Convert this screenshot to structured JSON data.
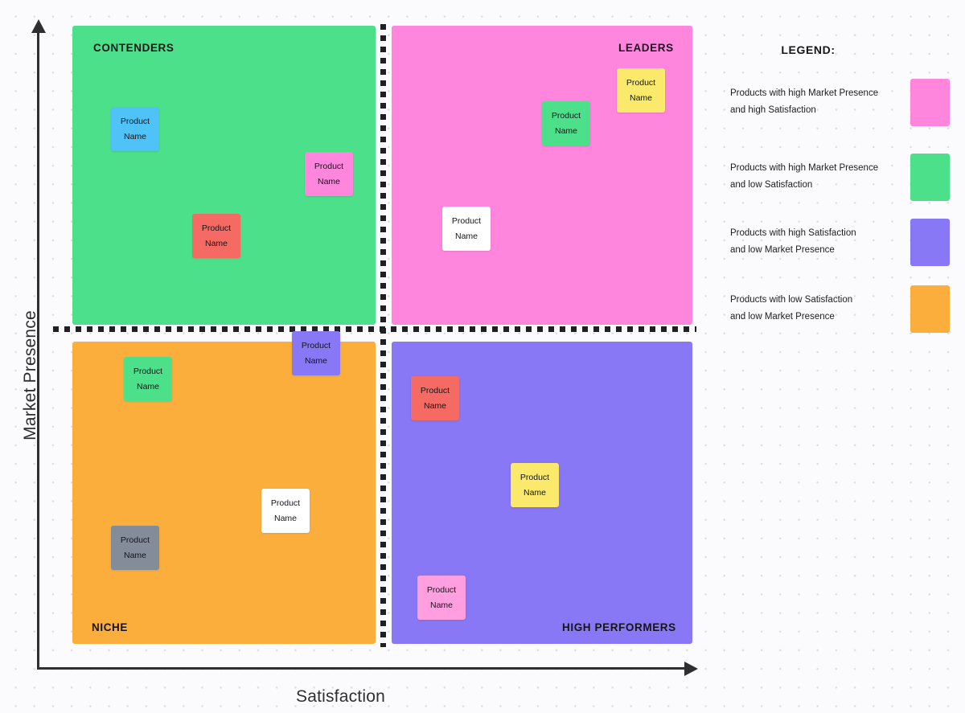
{
  "axes": {
    "y_label": "Market Presence",
    "x_label": "Satisfaction"
  },
  "quadrants": [
    {
      "key": "contenders",
      "label": "CONTENDERS",
      "color": "#4DE08A"
    },
    {
      "key": "leaders",
      "label": "LEADERS",
      "color": "#FF85DD"
    },
    {
      "key": "niche",
      "label": "NICHE",
      "color": "#FBAE3C"
    },
    {
      "key": "high",
      "label": "HIGH PERFORMERS",
      "color": "#8878F5"
    }
  ],
  "cards": [
    {
      "line1": "Product",
      "line2": "Name",
      "color": "#4FC3F7",
      "quadrant": "contenders"
    },
    {
      "line1": "Product",
      "line2": "Name",
      "color": "#FF85DD",
      "quadrant": "contenders"
    },
    {
      "line1": "Product",
      "line2": "Name",
      "color": "#F56B63",
      "quadrant": "contenders"
    },
    {
      "line1": "Product",
      "line2": "Name",
      "color": "#FAE96B",
      "quadrant": "leaders"
    },
    {
      "line1": "Product",
      "line2": "Name",
      "color": "#4DE08A",
      "quadrant": "leaders"
    },
    {
      "line1": "Product",
      "line2": "Name",
      "color": "#FFFFFF",
      "quadrant": "leaders"
    },
    {
      "line1": "Product",
      "line2": "Name",
      "color": "#8878F5",
      "quadrant": "boundary"
    },
    {
      "line1": "Product",
      "line2": "Name",
      "color": "#4DE08A",
      "quadrant": "niche"
    },
    {
      "line1": "Product",
      "line2": "Name",
      "color": "#FFFFFF",
      "quadrant": "niche"
    },
    {
      "line1": "Product",
      "line2": "Name",
      "color": "#858C99",
      "quadrant": "niche"
    },
    {
      "line1": "Product",
      "line2": "Name",
      "color": "#F56B63",
      "quadrant": "high"
    },
    {
      "line1": "Product",
      "line2": "Name",
      "color": "#FAE96B",
      "quadrant": "high"
    },
    {
      "line1": "Product",
      "line2": "Name",
      "color": "#FF9FE0",
      "quadrant": "high"
    }
  ],
  "legend": {
    "title": "LEGEND:",
    "items": [
      {
        "line1": "Products with high Market Presence",
        "line2": "and high Satisfaction",
        "color": "#FF85DD"
      },
      {
        "line1": "Products with high Market Presence",
        "line2": "and low Satisfaction",
        "color": "#4DE08A"
      },
      {
        "line1": "Products with high Satisfaction",
        "line2": "and low Market Presence",
        "color": "#8878F5"
      },
      {
        "line1": "Products with low Satisfaction",
        "line2": "and low Market Presence",
        "color": "#FBAE3C"
      }
    ]
  }
}
